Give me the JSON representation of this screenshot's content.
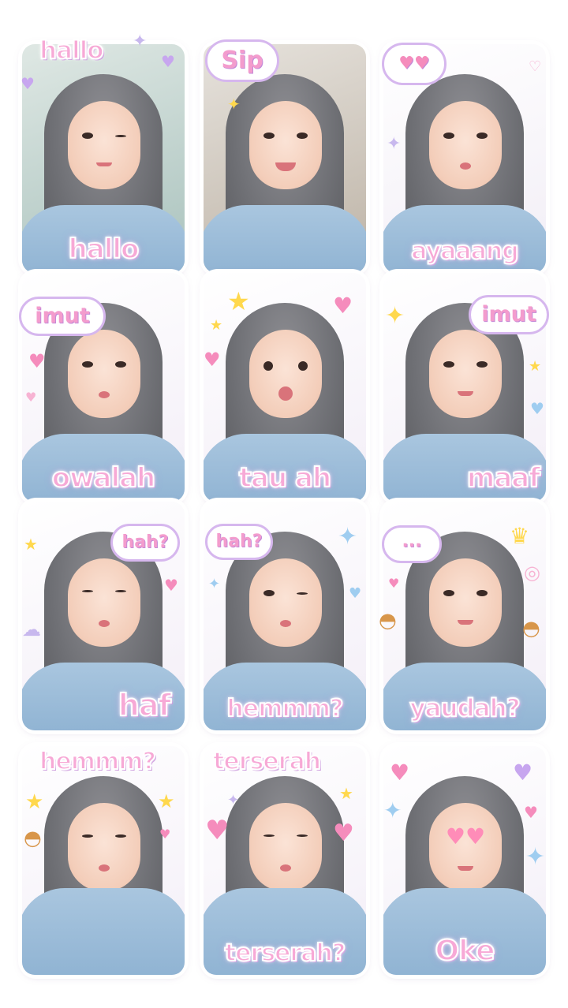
{
  "stickers": [
    {
      "caption": "hallo",
      "top_text": "hallo"
    },
    {
      "caption": "",
      "top_text": "Sip"
    },
    {
      "caption": "ayaaang",
      "top_text": ""
    },
    {
      "caption": "owalah",
      "top_text": "imut"
    },
    {
      "caption": "tau ah",
      "top_text": ""
    },
    {
      "caption": "maaf",
      "top_text": "imut"
    },
    {
      "caption": "haf",
      "top_text": "hah?"
    },
    {
      "caption": "hemmm?",
      "top_text": "hah?"
    },
    {
      "caption": "yaudah?",
      "top_text": "..."
    },
    {
      "caption": "",
      "top_text": "hemmm?"
    },
    {
      "caption": "terserah?",
      "top_text": "terserah"
    },
    {
      "caption": "Oke",
      "top_text": ""
    }
  ],
  "colors": {
    "text_pink": "#f7a9d6",
    "outline_purple": "#c48ad8",
    "hijab_gray": "#6f7075",
    "jacket_blue": "#8eb2d2"
  },
  "icons": [
    "heart-icon",
    "star-icon",
    "sparkle-icon",
    "burger-icon",
    "crown-icon",
    "donut-icon",
    "sunglasses-icon",
    "cloud-icon"
  ]
}
